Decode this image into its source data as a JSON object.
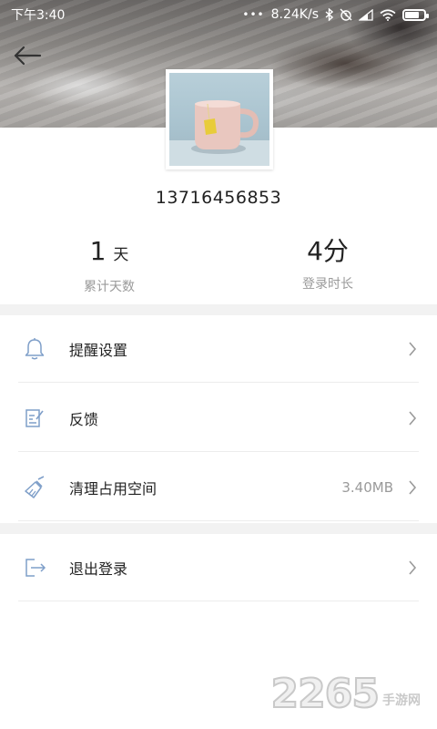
{
  "status_bar": {
    "time": "下午3:40",
    "network_speed": "8.24K/s",
    "icons": [
      "bluetooth-icon",
      "alarm-off-icon",
      "signal-icon",
      "wifi-icon",
      "battery-charging-icon"
    ]
  },
  "profile": {
    "phone": "13716456853",
    "avatar_icon": "coffee-mug-avatar"
  },
  "stats": {
    "days_value": "1",
    "days_unit": "天",
    "days_label": "累计天数",
    "duration_value": "4分",
    "duration_label": "登录时长"
  },
  "menu": {
    "reminder": {
      "label": "提醒设置",
      "icon": "bell-icon"
    },
    "feedback": {
      "label": "反馈",
      "icon": "edit-note-icon"
    },
    "clear_cache": {
      "label": "清理占用空间",
      "value": "3.40MB",
      "icon": "broom-icon"
    },
    "logout": {
      "label": "退出登录",
      "icon": "exit-icon"
    }
  },
  "watermark": {
    "number": "2265",
    "text": "手游网"
  },
  "colors": {
    "icon_blue": "#7f9fc9",
    "divider": "#ececec",
    "gap": "#f2f2f2",
    "muted_text": "#9a9a9a"
  }
}
